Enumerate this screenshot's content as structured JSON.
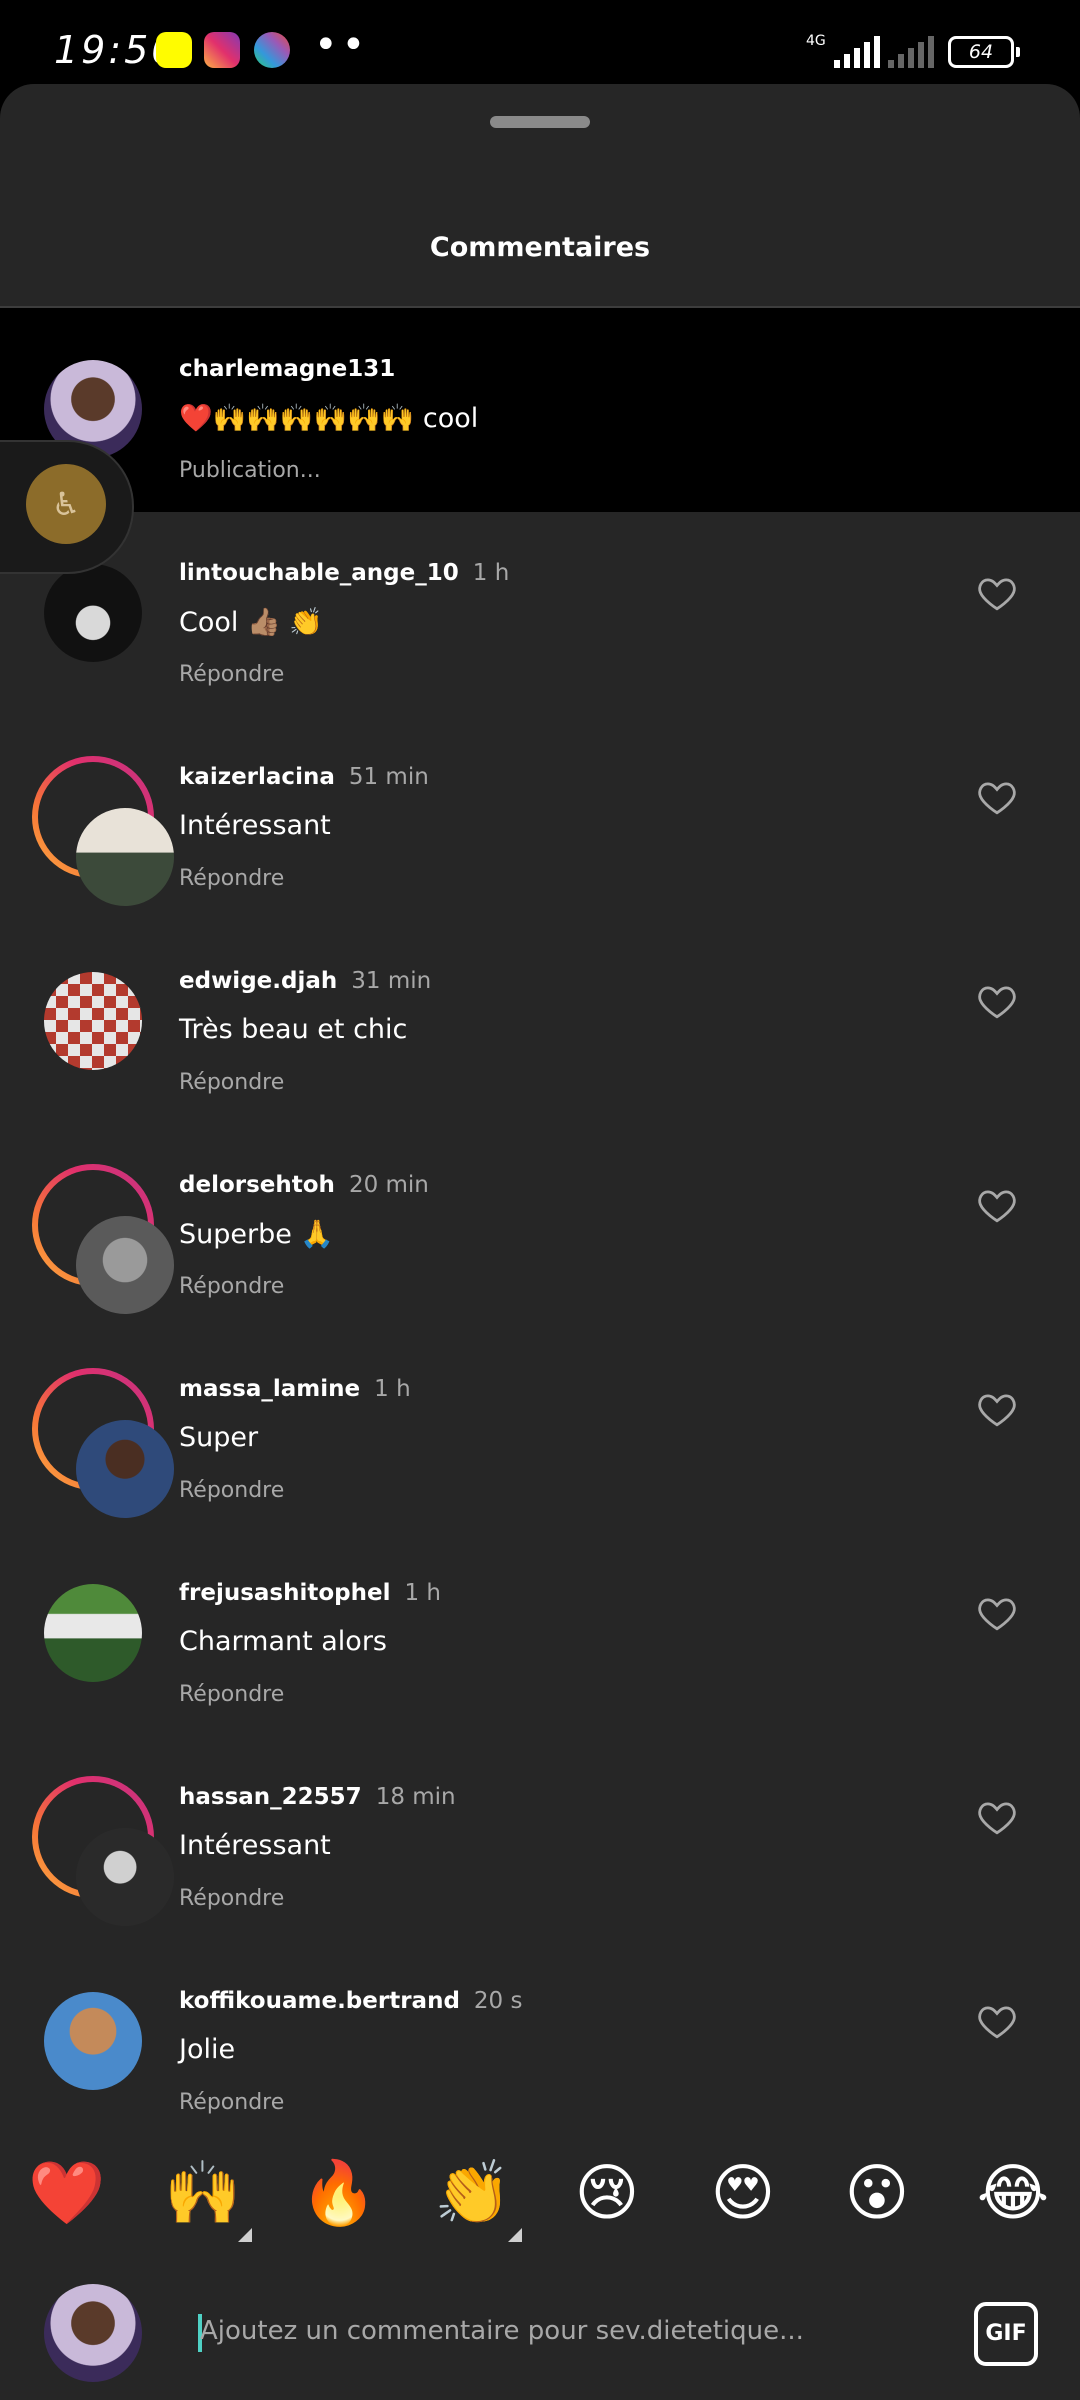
{
  "status_bar": {
    "time": "19:50",
    "network": "4G",
    "battery": "64",
    "app_icons": [
      "snapchat-icon",
      "instagram-icon",
      "photo-app-icon"
    ],
    "more": "••"
  },
  "sheet": {
    "title": "Commentaires"
  },
  "caption": {
    "username": "charlemagne131",
    "text": "❤️🙌🙌🙌🙌🙌🙌 cool",
    "label": "Publication..."
  },
  "comments": [
    {
      "username": "lintouchable_ange_10",
      "time": "1 h",
      "text": "Cool 👍🏽 👏",
      "reply": "Répondre"
    },
    {
      "username": "kaizerlacina",
      "time": "51 min",
      "text": "Intéressant",
      "reply": "Répondre"
    },
    {
      "username": "edwige.djah",
      "time": "31 min",
      "text": "Très beau et chic",
      "reply": "Répondre"
    },
    {
      "username": "delorsehtoh",
      "time": "20 min",
      "text": "Superbe 🙏",
      "reply": "Répondre"
    },
    {
      "username": "massa_lamine",
      "time": "1 h",
      "text": "Super",
      "reply": "Répondre"
    },
    {
      "username": "frejusashitophel",
      "time": "1 h",
      "text": "Charmant alors",
      "reply": "Répondre"
    },
    {
      "username": "hassan_22557",
      "time": "18 min",
      "text": "Intéressant",
      "reply": "Répondre"
    },
    {
      "username": "koffikouame.bertrand",
      "time": "20 s",
      "text": "Jolie",
      "reply": "Répondre"
    }
  ],
  "emoji_bar": [
    "❤️",
    "🙌",
    "🔥",
    "👏",
    "😢",
    "😍",
    "😮",
    "😂"
  ],
  "input": {
    "placeholder": "Ajoutez un commentaire pour sev.dietetique...",
    "gif_label": "GIF"
  },
  "colors": {
    "sheet_bg": "#262626",
    "muted_text": "#a8a8a8",
    "story_ring": "#e1306c"
  }
}
